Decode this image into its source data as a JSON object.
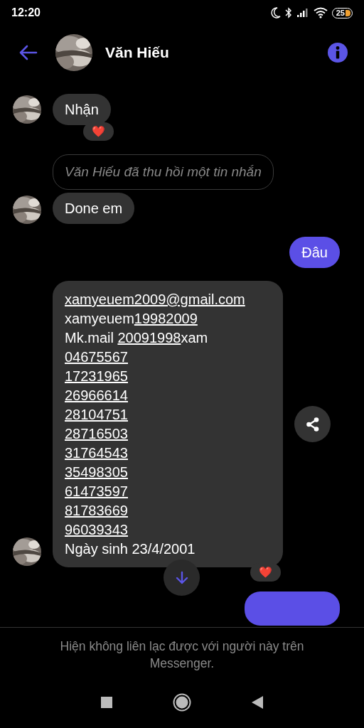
{
  "status_bar": {
    "time": "12:20",
    "battery": "25"
  },
  "header": {
    "contact_name": "Văn Hiếu"
  },
  "messages": [
    {
      "kind": "incoming",
      "reaction": "❤️",
      "lines": [
        [
          {
            "text": "Nhận",
            "link": false
          }
        ]
      ]
    },
    {
      "kind": "recalled",
      "lines": [
        [
          {
            "text": "Văn Hiếu đã thu hồi một tin nhắn",
            "link": false
          }
        ]
      ]
    },
    {
      "kind": "incoming",
      "lines": [
        [
          {
            "text": "Done em",
            "link": false
          }
        ]
      ]
    },
    {
      "kind": "outgoing",
      "lines": [
        [
          {
            "text": "Đâu",
            "link": false
          }
        ]
      ]
    },
    {
      "kind": "incoming",
      "share": true,
      "reaction": "❤️",
      "lines": [
        [
          {
            "text": "xamyeuem2009@gmail.com",
            "link": true
          }
        ],
        [
          {
            "text": "xamyeuem",
            "link": false
          },
          {
            "text": "19982009",
            "link": true
          }
        ],
        [
          {
            "text": "Mk.mail ",
            "link": false
          },
          {
            "text": "20091998",
            "link": true
          },
          {
            "text": "xam",
            "link": false
          }
        ],
        [
          {
            "text": "04675567",
            "link": true
          }
        ],
        [
          {
            "text": "17231965",
            "link": true
          }
        ],
        [
          {
            "text": "26966614",
            "link": true
          }
        ],
        [
          {
            "text": "28104751",
            "link": true
          }
        ],
        [
          {
            "text": "28716503",
            "link": true
          }
        ],
        [
          {
            "text": "31764543",
            "link": true
          }
        ],
        [
          {
            "text": "35498305",
            "link": true
          }
        ],
        [
          {
            "text": "61473597",
            "link": true
          }
        ],
        [
          {
            "text": "81783669",
            "link": true
          }
        ],
        [
          {
            "text": "96039343",
            "link": true
          }
        ],
        [
          {
            "text": "Ngày sinh 23/4/2001",
            "link": false
          }
        ]
      ]
    },
    {
      "kind": "outgoing-cut"
    }
  ],
  "footer": {
    "notice": "Hiện không liên lạc được với người này trên Messenger."
  }
}
